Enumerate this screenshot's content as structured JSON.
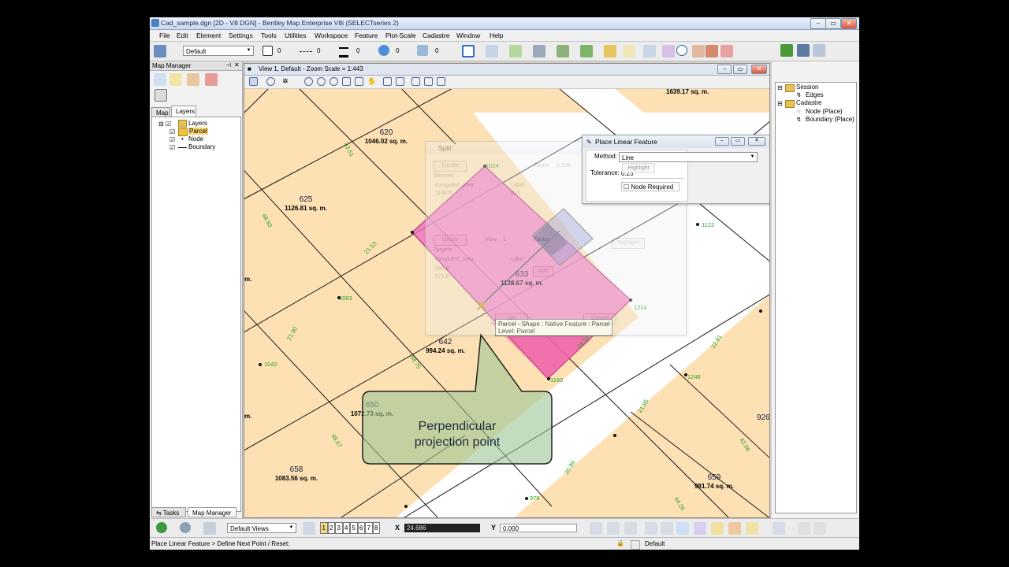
{
  "window": {
    "title": "Cad_sample.dgn [2D - V8 DGN] - Bentley Map Enterprise V8i (SELECTseries 2)"
  },
  "menu": [
    "File",
    "Edit",
    "Element",
    "Settings",
    "Tools",
    "Utilities",
    "Workspace",
    "Feature",
    "Plot-Scale",
    "Cadastre",
    "Window",
    "Help"
  ],
  "toolbar1": {
    "level_combo": "Default",
    "color_value": "0",
    "style_value": "0",
    "weight_value": "0",
    "transparency_value": "0",
    "priority_value": "0"
  },
  "map_manager": {
    "title": "Map Manager",
    "tabs": [
      "Map",
      "Layers"
    ],
    "tree": {
      "root": "Layers",
      "items": [
        "Parcel",
        "Node",
        "Boundary"
      ]
    },
    "bottom_tabs": [
      "Tasks",
      "Map Manager"
    ]
  },
  "view": {
    "title": "View 1, Default - Zoom Scale = 1:443"
  },
  "right_tree": {
    "items": [
      "Session",
      "Edges",
      "Cadastre",
      "Node (Place)",
      "Boundary (Place)"
    ]
  },
  "parcels": [
    {
      "id": "620",
      "area": "1046.02  sq. m."
    },
    {
      "id": "625",
      "area": "1126.81  sq. m."
    },
    {
      "id": "633",
      "area": "1138.67  sq. m."
    },
    {
      "id": "642",
      "area": "994.24  sq. m."
    },
    {
      "id": "650",
      "area": "1072.73  sq. m."
    },
    {
      "id": "658",
      "area": "1083.56  sq. m."
    },
    {
      "id": "659",
      "area": "981.74  sq. m."
    },
    {
      "id": "926",
      "area": ""
    }
  ],
  "top_clip_text": "1639.17  sq. m.",
  "split_dialog": {
    "title": "Split",
    "locate1": "Locate",
    "locate2": "Locate",
    "factor_label": "Factor",
    "factor_value": "1.200",
    "sources_label": "Sources",
    "col_computed": "computed_area",
    "col_label": "Label",
    "row1a": "1138.6",
    "row1b": "633",
    "view_label": "View",
    "view_value": "1",
    "factor2_label": "Factor",
    "highlight": "Highlight",
    "targets_label": "Targets",
    "col_computed2": "computed_area",
    "col_label2": "Label",
    "row2a": "566.8",
    "row2b": "571.8",
    "add": "Add",
    "ok": "OK",
    "cancel": "Cancel"
  },
  "place_dialog": {
    "title": "Place Linear Feature",
    "method_label": "Method:",
    "method_value": "Line",
    "highlight": "Highlight",
    "tolerance_label": "Tolerance:",
    "tolerance_value": "0.25",
    "node_required": "Node Required"
  },
  "tooltip": {
    "line1": "Parcel - Shape : Native Feature : Parcel",
    "line2": "Level: Parcel"
  },
  "callout": {
    "line1": "Perpendicular",
    "line2": "projection point"
  },
  "bottom_toolbar": {
    "views_combo": "Default Views",
    "view_numbers": [
      "1",
      "2",
      "3",
      "4",
      "5",
      "6",
      "7",
      "8"
    ],
    "x_label": "X",
    "x_value": "24.686",
    "y_label": "Y",
    "y_value": "0.000"
  },
  "status": {
    "prompt": "Place Linear Feature > Define Next Point / Reset:",
    "level": "Default"
  },
  "node_labels": [
    "43.51",
    "21.53",
    "1063",
    "1042",
    "48.93",
    "48.67",
    "48.75",
    "21.90",
    "1224",
    "1248",
    "22.81",
    "42.06",
    "21.95",
    "20.99",
    "1160",
    "976",
    "44.26",
    "1122",
    "1024",
    "24.29"
  ]
}
